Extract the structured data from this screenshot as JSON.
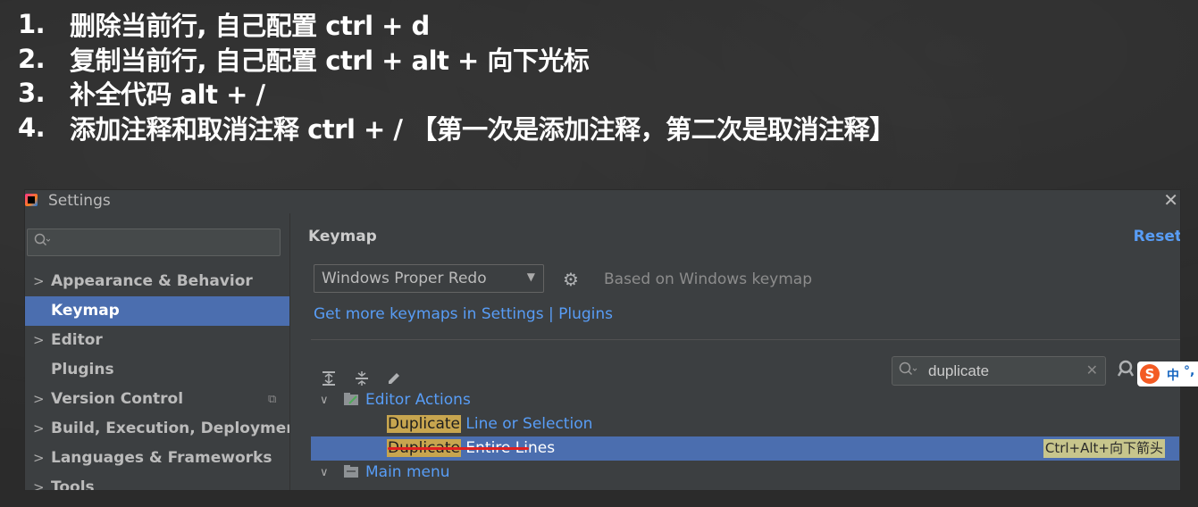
{
  "notes": [
    {
      "num": "1.",
      "text": "删除当前行, 自己配置 ctrl + d"
    },
    {
      "num": "2.",
      "text": "复制当前行, 自己配置 ctrl + alt + 向下光标"
    },
    {
      "num": "3.",
      "text": "补全代码  alt + /"
    },
    {
      "num": "4.",
      "text": "添加注释和取消注释 ctrl + / 【第一次是添加注释，第二次是取消注释】"
    }
  ],
  "window": {
    "title": "Settings",
    "close": "✕"
  },
  "sidebar": {
    "search_icon": "search-icon",
    "items": [
      {
        "label": "Appearance & Behavior",
        "expandable": true
      },
      {
        "label": "Keymap",
        "expandable": false,
        "selected": true
      },
      {
        "label": "Editor",
        "expandable": true
      },
      {
        "label": "Plugins",
        "expandable": false
      },
      {
        "label": "Version Control",
        "expandable": true
      },
      {
        "label": "Build, Execution, Deployment",
        "expandable": true
      },
      {
        "label": "Languages & Frameworks",
        "expandable": true
      },
      {
        "label": "Tools",
        "expandable": true
      }
    ]
  },
  "main": {
    "title": "Keymap",
    "reset": "Reset",
    "keymap_select": "Windows Proper Redo",
    "based_on": "Based on Windows keymap",
    "more_link": "Get more keymaps in Settings | Plugins",
    "filter_value": "duplicate",
    "tree": {
      "group1": "Editor Actions",
      "item1_highlight": "Duplicate",
      "item1_rest": " Line or Selection",
      "item2_highlight": "Duplicate",
      "item2_rest": " Entire Lines",
      "item2_shortcut": "Ctrl+Alt+向下箭头",
      "group2": "Main menu"
    }
  },
  "ime": {
    "logo": "S",
    "lang": "中",
    "punct": "°,"
  },
  "colors": {
    "selection": "#4b6eaf",
    "link": "#589df6",
    "match_highlight": "#c7a54f",
    "annotation_underline": "#e02020"
  }
}
